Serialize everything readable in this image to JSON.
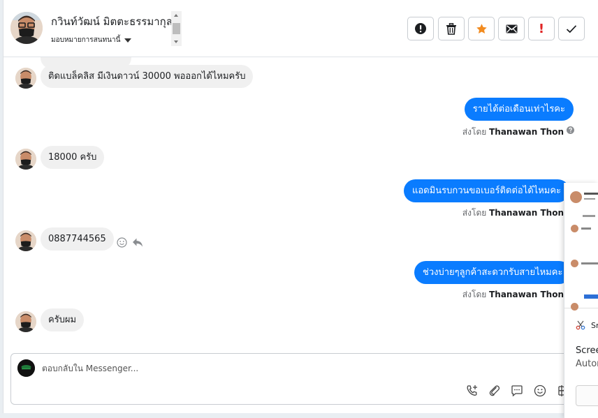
{
  "header": {
    "contact_name": "กวินท์วัฒน์ มิตตะธรรมากุล",
    "assign_label": "มอบหมายการสนทนานี้"
  },
  "toolbar": {
    "buttons": [
      "warning",
      "delete",
      "star",
      "mail",
      "alert",
      "done"
    ],
    "alert_glyph": "!"
  },
  "messages": {
    "m1": "ติดแบล็คลิส มีเงินดาวน์ 30000 พอออกได้ไหมครับ",
    "m2": "รายได้ต่อเดือนเท่าไรคะ",
    "m3": "18000 ครับ",
    "m4": "แอดมินรบกวนขอเบอร์ติดต่อได้ไหมคะ",
    "m5": "0887744565",
    "m6": "ช่วงบ่ายๆลูกค้าสะดวกรับสายไหมคะ",
    "m7": "ครับผม"
  },
  "sent_by": {
    "prefix": "ส่งโดย",
    "agent": "Thanawan Thon"
  },
  "composer": {
    "placeholder": "ตอบกลับใน Messenger..."
  },
  "popup": {
    "snip_label": "Sn",
    "line1": "Scree",
    "line2": "Autor"
  }
}
